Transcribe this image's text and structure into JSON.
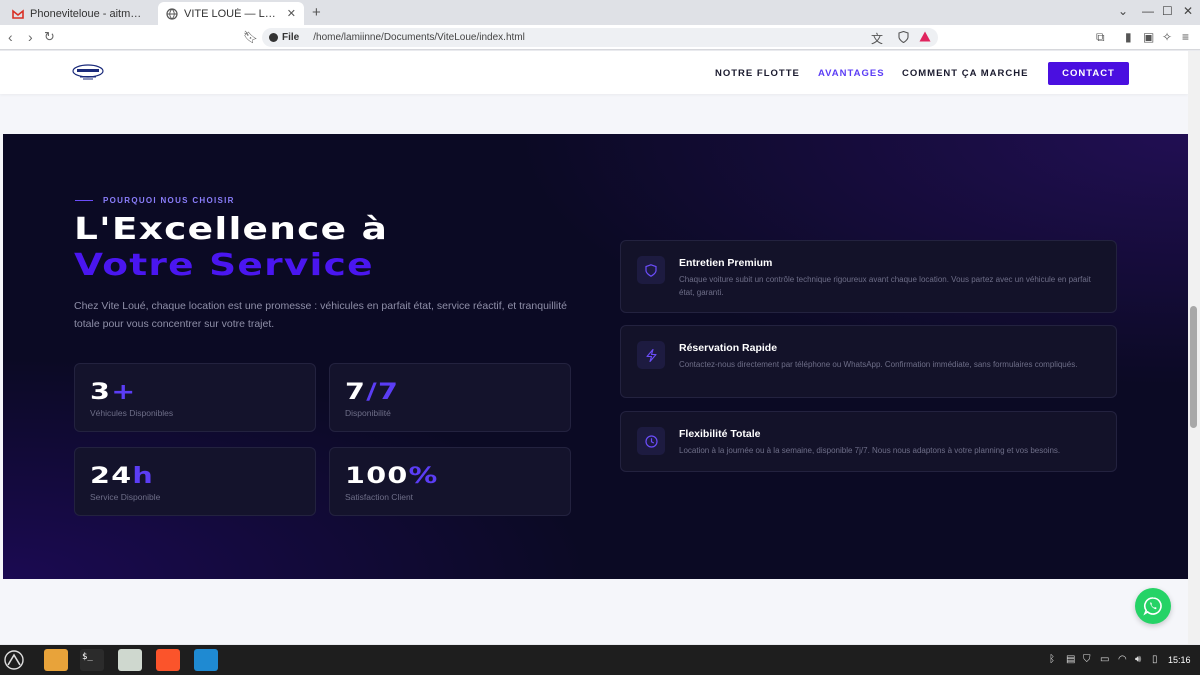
{
  "browser": {
    "tabs": [
      {
        "label": "Phoneviteloue - aitmoulamohamed",
        "icon": "gmail-icon",
        "active": false
      },
      {
        "label": "VITE LOUÉ — Location de Voiture",
        "icon": "globe-icon",
        "active": true
      }
    ],
    "new_tab": "+",
    "address": {
      "scheme": "File",
      "url": "/home/lamiinne/Documents/ViteLoue/index.html"
    }
  },
  "site": {
    "logo": "VITE LOUÉ",
    "nav": [
      {
        "label": "NOTRE FLOTTE",
        "active": false
      },
      {
        "label": "AVANTAGES",
        "active": true
      },
      {
        "label": "COMMENT ÇA MARCHE",
        "active": false
      }
    ],
    "contact_label": "CONTACT"
  },
  "section": {
    "eyebrow": "POURQUOI NOUS CHOISIR",
    "title_line1": "L'Excellence à",
    "title_line2": "Votre Service",
    "lead": "Chez Vite Loué, chaque location est une promesse : véhicules en parfait état, service réactif, et tranquillité totale pour vous concentrer sur votre trajet.",
    "stats": [
      {
        "main": "3",
        "accent": "+",
        "label": "Véhicules Disponibles"
      },
      {
        "main": "7",
        "accent": "/7",
        "label": "Disponibilité"
      },
      {
        "main": "24",
        "accent": "h",
        "label": "Service Disponible"
      },
      {
        "main": "100",
        "accent": "%",
        "label": "Satisfaction Client"
      }
    ],
    "features": [
      {
        "icon": "shield-icon",
        "title": "Entretien Premium",
        "desc": "Chaque voiture subit un contrôle technique rigoureux avant chaque location. Vous partez avec un véhicule en parfait état, garanti."
      },
      {
        "icon": "lightning-icon",
        "title": "Réservation Rapide",
        "desc": "Contactez-nous directement par téléphone ou WhatsApp. Confirmation immédiate, sans formulaires compliqués."
      },
      {
        "icon": "clock-icon",
        "title": "Flexibilité Totale",
        "desc": "Location à la journée ou à la semaine, disponible 7j/7. Nous nous adaptons à votre planning et vos besoins."
      }
    ]
  },
  "taskbar": {
    "apps": [
      "files-icon",
      "terminal-icon",
      "settings-icon",
      "brave-icon",
      "vscode-icon"
    ],
    "clock": "15:16"
  },
  "colors": {
    "accent": "#4a0fe0",
    "dark_bg": "#0b0a24",
    "whatsapp": "#25d366"
  }
}
